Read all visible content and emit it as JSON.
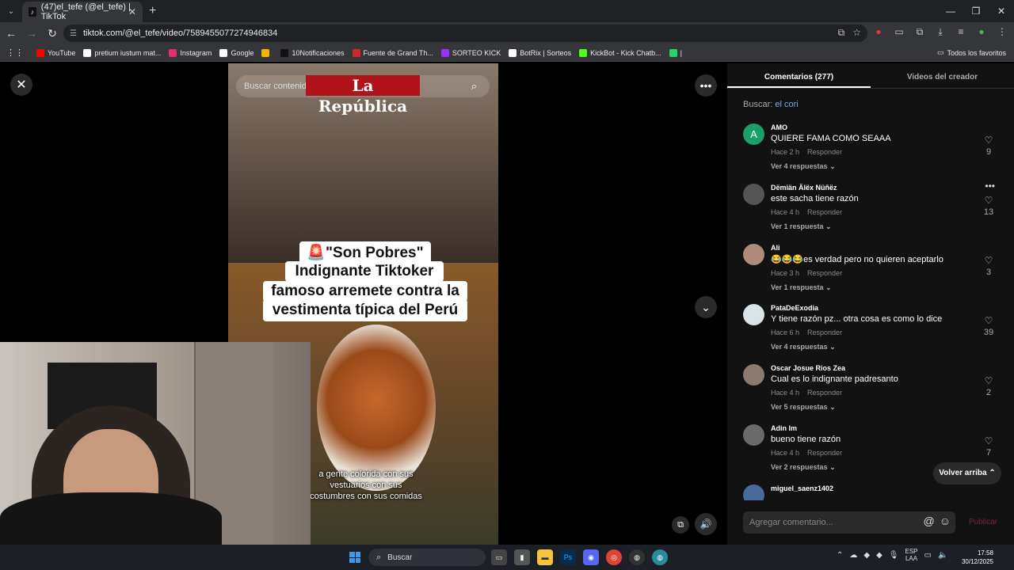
{
  "browser": {
    "tab_title": "(47)el_tefe (@el_tefe) | TikTok",
    "url": "tiktok.com/@el_tefe/video/7589455077274946834",
    "bookmarks": [
      {
        "label": "YouTube",
        "color": "#ff0000"
      },
      {
        "label": "pretium iustum mat...",
        "color": "#ffffff"
      },
      {
        "label": "Instagram",
        "color": "#e1306c"
      },
      {
        "label": "Google",
        "color": "#ffffff"
      },
      {
        "label": "",
        "color": "#f4b400"
      },
      {
        "label": "10Notificaciones",
        "color": "#111111"
      },
      {
        "label": "Fuente de Grand Th...",
        "color": "#cc2a2a"
      },
      {
        "label": "SORTEO KICK",
        "color": "#9b30ff"
      },
      {
        "label": "BotRix | Sorteos",
        "color": "#ffffff"
      },
      {
        "label": "KickBot - Kick Chatb...",
        "color": "#53fc18"
      },
      {
        "label": "|",
        "color": "#25d366"
      }
    ],
    "all_bookmarks": "Todos los favoritos"
  },
  "video": {
    "search_placeholder": "Buscar contenido relacionado",
    "brand": "La República",
    "caption_lines": [
      "🚨\"Son Pobres\"",
      "Indignante Tiktoker",
      "famoso arremete contra la",
      "vestimenta típica del Perú"
    ],
    "subtitle": "a gente colorida con sus vestuarios con sus costumbres con sus comidas"
  },
  "panel": {
    "tab_comments": "Comentarios (277)",
    "tab_creator": "Videos del creador",
    "search_label": "Buscar:",
    "search_term": "el cori",
    "reply_label": "Responder",
    "back_to_top": "Volver arriba",
    "comment_placeholder": "Agregar comentario...",
    "publish": "Publicar",
    "comments": [
      {
        "user": "AMO",
        "avatar": "A",
        "avatar_color": "#1a9e6a",
        "text": "QUIERE FAMA COMO SEAAA",
        "time": "Hace 2 h",
        "replies": "Ver 4 respuestas",
        "likes": "9"
      },
      {
        "user": "Dëmiän Älëx Nüñëz",
        "avatar": "",
        "avatar_color": "#555555",
        "text": "este sacha tiene razón",
        "time": "Hace 4 h",
        "replies": "Ver 1 respuesta",
        "likes": "13"
      },
      {
        "user": "Ali",
        "avatar": "",
        "avatar_color": "#b08a7a",
        "text": "😂😂😂es verdad pero no quieren aceptarlo",
        "time": "Hace 3 h",
        "replies": "Ver 1 respuesta",
        "likes": "3"
      },
      {
        "user": "PataDeExodia",
        "avatar": "",
        "avatar_color": "#d8e4e8",
        "text": "Y tiene razón pz... otra cosa es como lo dice",
        "time": "Hace 6 h",
        "replies": "Ver 4 respuestas",
        "likes": "39"
      },
      {
        "user": "Oscar Josue Rios Zea",
        "avatar": "",
        "avatar_color": "#8a7a70",
        "text": "Cual es lo indignante padresanto",
        "time": "Hace 4 h",
        "replies": "Ver 5 respuestas",
        "likes": "2"
      },
      {
        "user": "Adin lm",
        "avatar": "",
        "avatar_color": "#6a6a6a",
        "text": "bueno tiene razón",
        "time": "Hace 4 h",
        "replies": "Ver 2 respuestas",
        "likes": "7"
      },
      {
        "user": "miguel_saenz1402",
        "avatar": "",
        "avatar_color": "#4a6a9a",
        "text": "",
        "time": "",
        "replies": "",
        "likes": ""
      }
    ]
  },
  "taskbar": {
    "search": "Buscar",
    "lang_top": "ESP",
    "lang_bottom": "LAA",
    "time": "17:58",
    "date": "30/12/2025"
  }
}
